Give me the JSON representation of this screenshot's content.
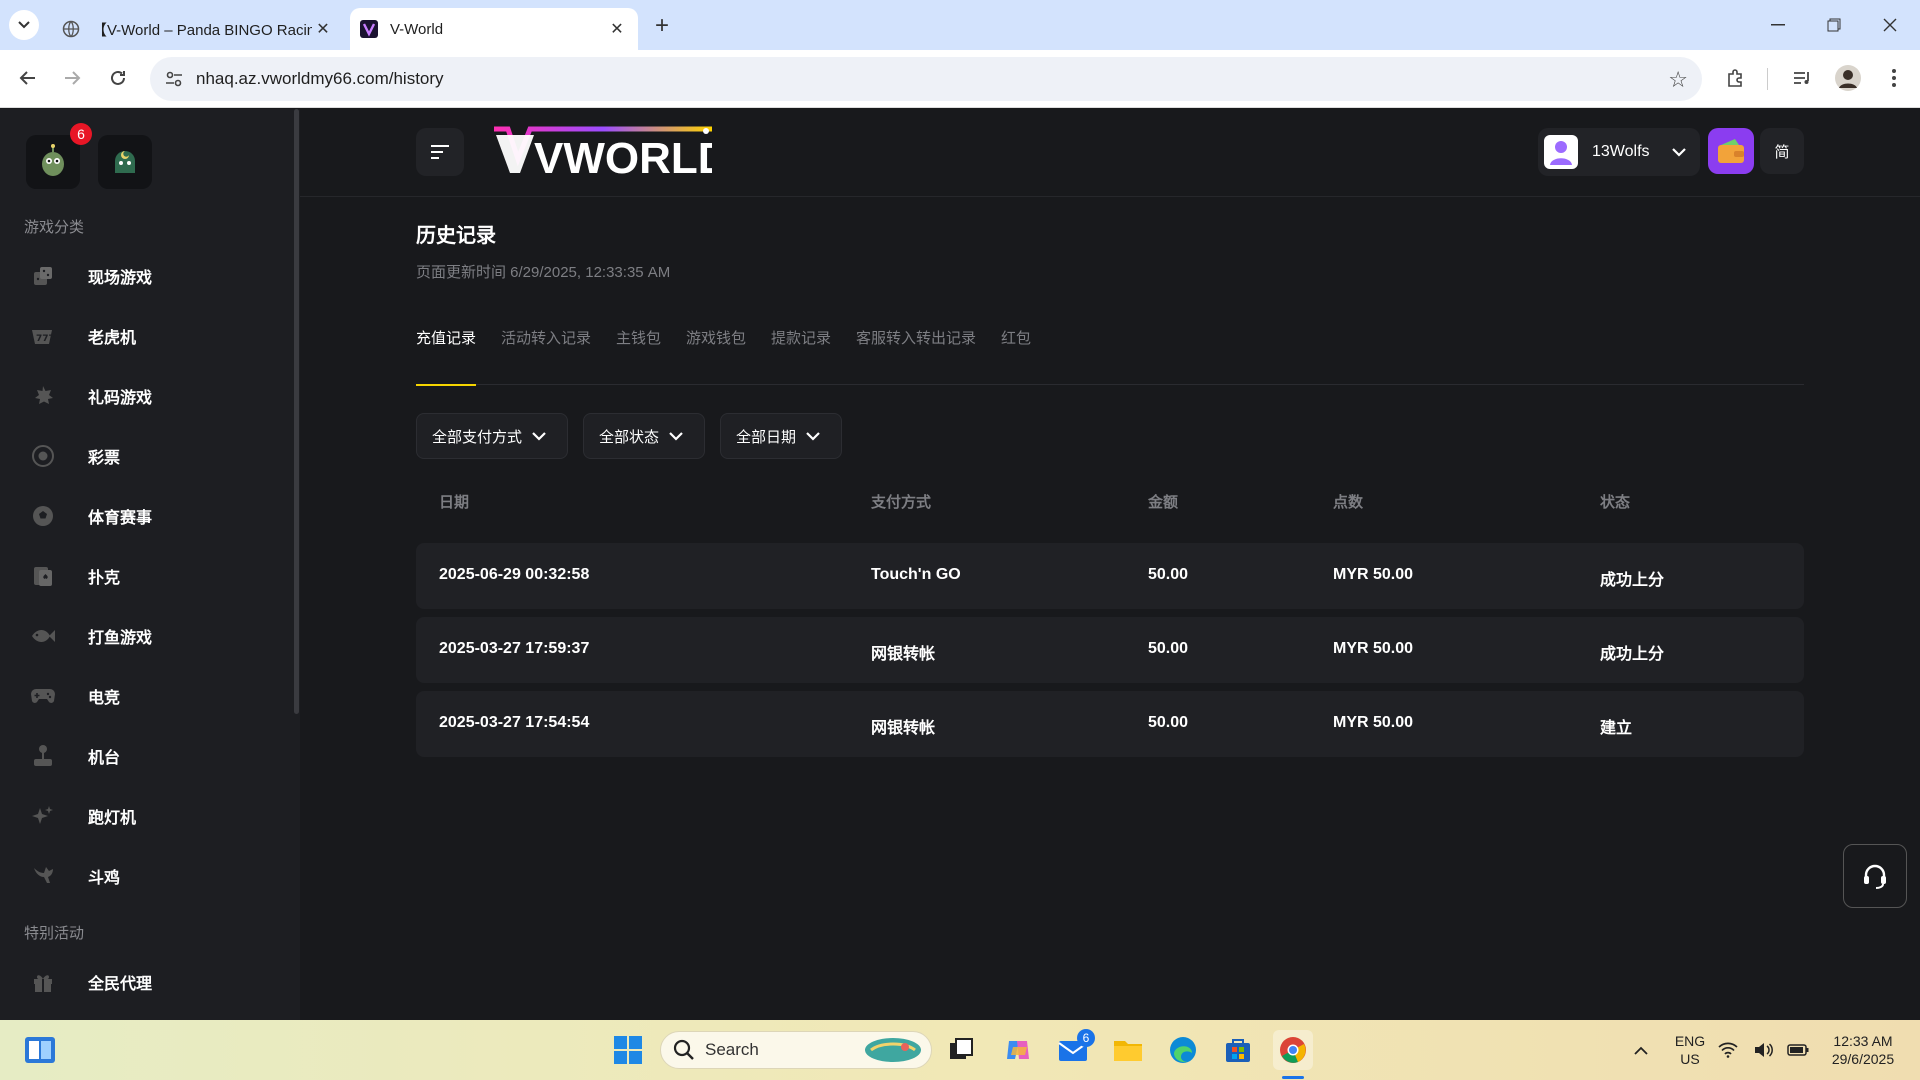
{
  "browser": {
    "tabs": [
      {
        "title": "【V-World – Panda BINGO Racin",
        "active": false
      },
      {
        "title": "V-World",
        "active": true
      }
    ],
    "url": "nhaq.az.vworldmy66.com/history"
  },
  "sidebar": {
    "notification_count": "6",
    "section_games": "游戏分类",
    "items": [
      {
        "label": "现场游戏",
        "icon": "live-casino-icon"
      },
      {
        "label": "老虎机",
        "icon": "slot-machine-icon"
      },
      {
        "label": "礼码游戏",
        "icon": "bomb-icon"
      },
      {
        "label": "彩票",
        "icon": "lottery-icon"
      },
      {
        "label": "体育赛事",
        "icon": "soccer-ball-icon"
      },
      {
        "label": "扑克",
        "icon": "poker-card-icon"
      },
      {
        "label": "打鱼游戏",
        "icon": "fish-icon"
      },
      {
        "label": "电竞",
        "icon": "gamepad-icon"
      },
      {
        "label": "机台",
        "icon": "arcade-joystick-icon"
      },
      {
        "label": "跑灯机",
        "icon": "sparkle-icon"
      },
      {
        "label": "斗鸡",
        "icon": "rooster-icon"
      }
    ],
    "section_events": "特别活动",
    "event_items": [
      {
        "label": "全民代理",
        "icon": "gift-icon"
      }
    ]
  },
  "header": {
    "logo_text": "VWORLD",
    "username": "13Wolfs",
    "language": "简"
  },
  "page": {
    "title": "历史记录",
    "update_time": "页面更新时间 6/29/2025, 12:33:35 AM",
    "tabs": [
      "充值记录",
      "活动转入记录",
      "主钱包",
      "游戏钱包",
      "提款记录",
      "客服转入转出记录",
      "红包"
    ],
    "active_tab": "充值记录",
    "filters": [
      "全部支付方式",
      "全部状态",
      "全部日期"
    ],
    "table": {
      "headers": [
        "日期",
        "支付方式",
        "金额",
        "点数",
        "状态"
      ],
      "rows": [
        [
          "2025-06-29 00:32:58",
          "Touch'n GO",
          "50.00",
          "MYR 50.00",
          "成功上分"
        ],
        [
          "2025-03-27 17:59:37",
          "网银转帐",
          "50.00",
          "MYR 50.00",
          "成功上分"
        ],
        [
          "2025-03-27 17:54:54",
          "网银转帐",
          "50.00",
          "MYR 50.00",
          "建立"
        ]
      ]
    }
  },
  "taskbar": {
    "search_placeholder": "Search",
    "mail_badge": "6",
    "lang_line1": "ENG",
    "lang_line2": "US",
    "time": "12:33 AM",
    "date": "29/6/2025"
  },
  "colors": {
    "accent_tab_underline": "#f5d400",
    "wallet_button": "#8b3df0",
    "badge_red": "#e81626"
  }
}
